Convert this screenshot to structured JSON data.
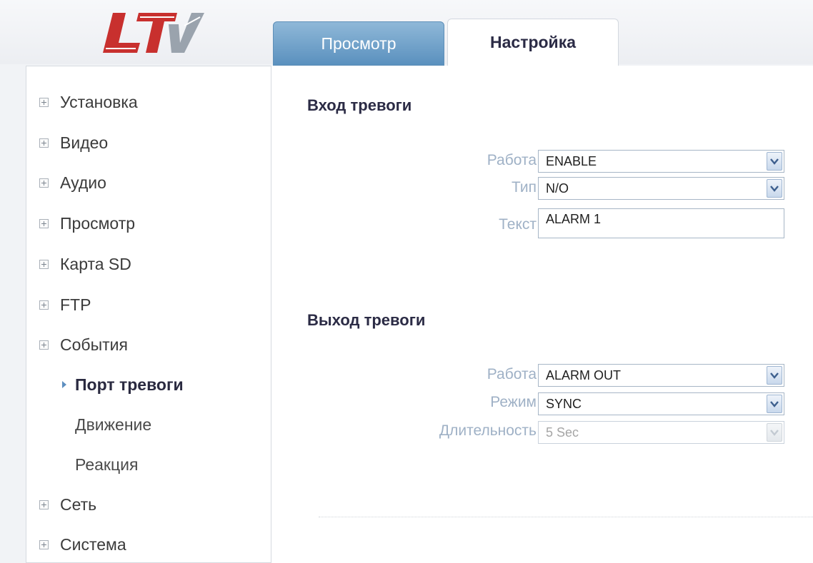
{
  "logo": {
    "text": "LTV",
    "color": "#c8302e"
  },
  "tabs": [
    {
      "label": "Просмотр",
      "active": false
    },
    {
      "label": "Настройка",
      "active": true
    }
  ],
  "sidebar": {
    "items": [
      {
        "label": "Установка"
      },
      {
        "label": "Видео"
      },
      {
        "label": "Аудио"
      },
      {
        "label": "Просмотр"
      },
      {
        "label": "Карта SD"
      },
      {
        "label": "FTP"
      },
      {
        "label": "События"
      }
    ],
    "subitems": [
      {
        "label": "Порт тревоги",
        "active": true
      },
      {
        "label": "Движение",
        "active": false
      },
      {
        "label": "Реакция",
        "active": false
      }
    ],
    "items_after": [
      {
        "label": "Сеть"
      },
      {
        "label": "Система"
      }
    ]
  },
  "alarm_input": {
    "title": "Вход тревоги",
    "operation_label": "Работа",
    "operation_value": "ENABLE",
    "type_label": "Тип",
    "type_value": "N/O",
    "text_label": "Текст",
    "text_value": "ALARM 1"
  },
  "alarm_output": {
    "title": "Выход тревоги",
    "operation_label": "Работа",
    "operation_value": "ALARM OUT",
    "mode_label": "Режим",
    "mode_value": "SYNC",
    "duration_label": "Длительность",
    "duration_value": "5 Sec",
    "duration_disabled": true
  },
  "colors": {
    "accent": "#5a90be",
    "label": "#9fb1c6",
    "heading": "#2b2b45"
  }
}
